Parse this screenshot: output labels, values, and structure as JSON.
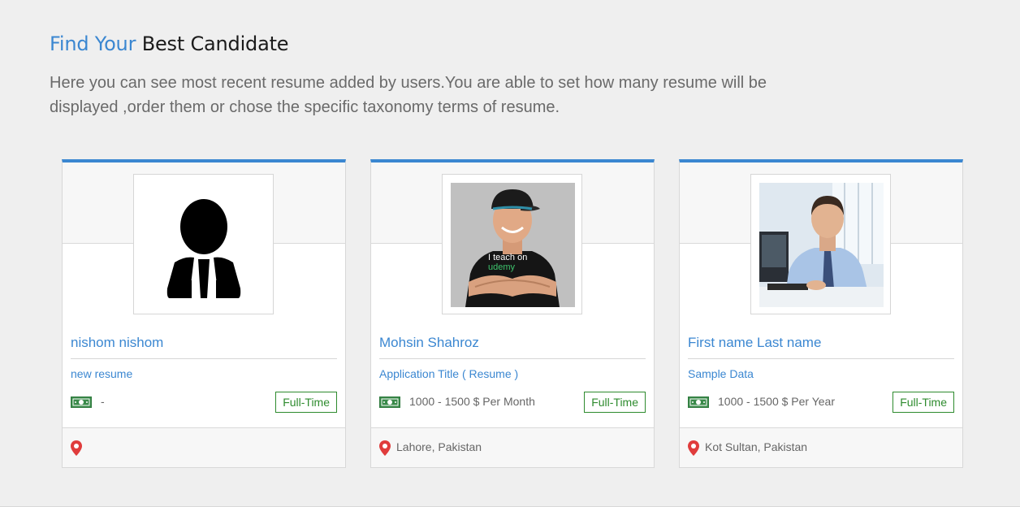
{
  "header": {
    "title_accent": "Find Your",
    "title_rest": "Best Candidate",
    "intro": "Here you can see most recent resume added by users.You are able to set how many resume will be displayed ,order them or chose the specific taxonomy terms of resume."
  },
  "colors": {
    "accent": "#3b87d1",
    "badge_green": "#2e8b2e",
    "pin_red": "#e03c3c"
  },
  "cards": [
    {
      "name": "nishom nishom",
      "resume_title": "new resume",
      "salary": "-",
      "job_type": "Full-Time",
      "location": "",
      "photo": "default-avatar-silhouette",
      "salary_icon": "money-icon",
      "location_icon": "map-pin-icon"
    },
    {
      "name": "Mohsin Shahroz",
      "resume_title": "Application Title ( Resume )",
      "salary": "1000 - 1500 $ Per Month",
      "job_type": "Full-Time",
      "location": "Lahore, Pakistan",
      "photo": "man-in-cap-photo",
      "shirt_text": "I teach on udemy",
      "salary_icon": "money-icon",
      "location_icon": "map-pin-icon"
    },
    {
      "name": "First name Last name",
      "resume_title": "Sample Data",
      "salary": "1000 - 1500 $ Per Year",
      "job_type": "Full-Time",
      "location": "Kot Sultan, Pakistan",
      "photo": "businessman-at-desk-photo",
      "salary_icon": "money-icon",
      "location_icon": "map-pin-icon"
    }
  ]
}
